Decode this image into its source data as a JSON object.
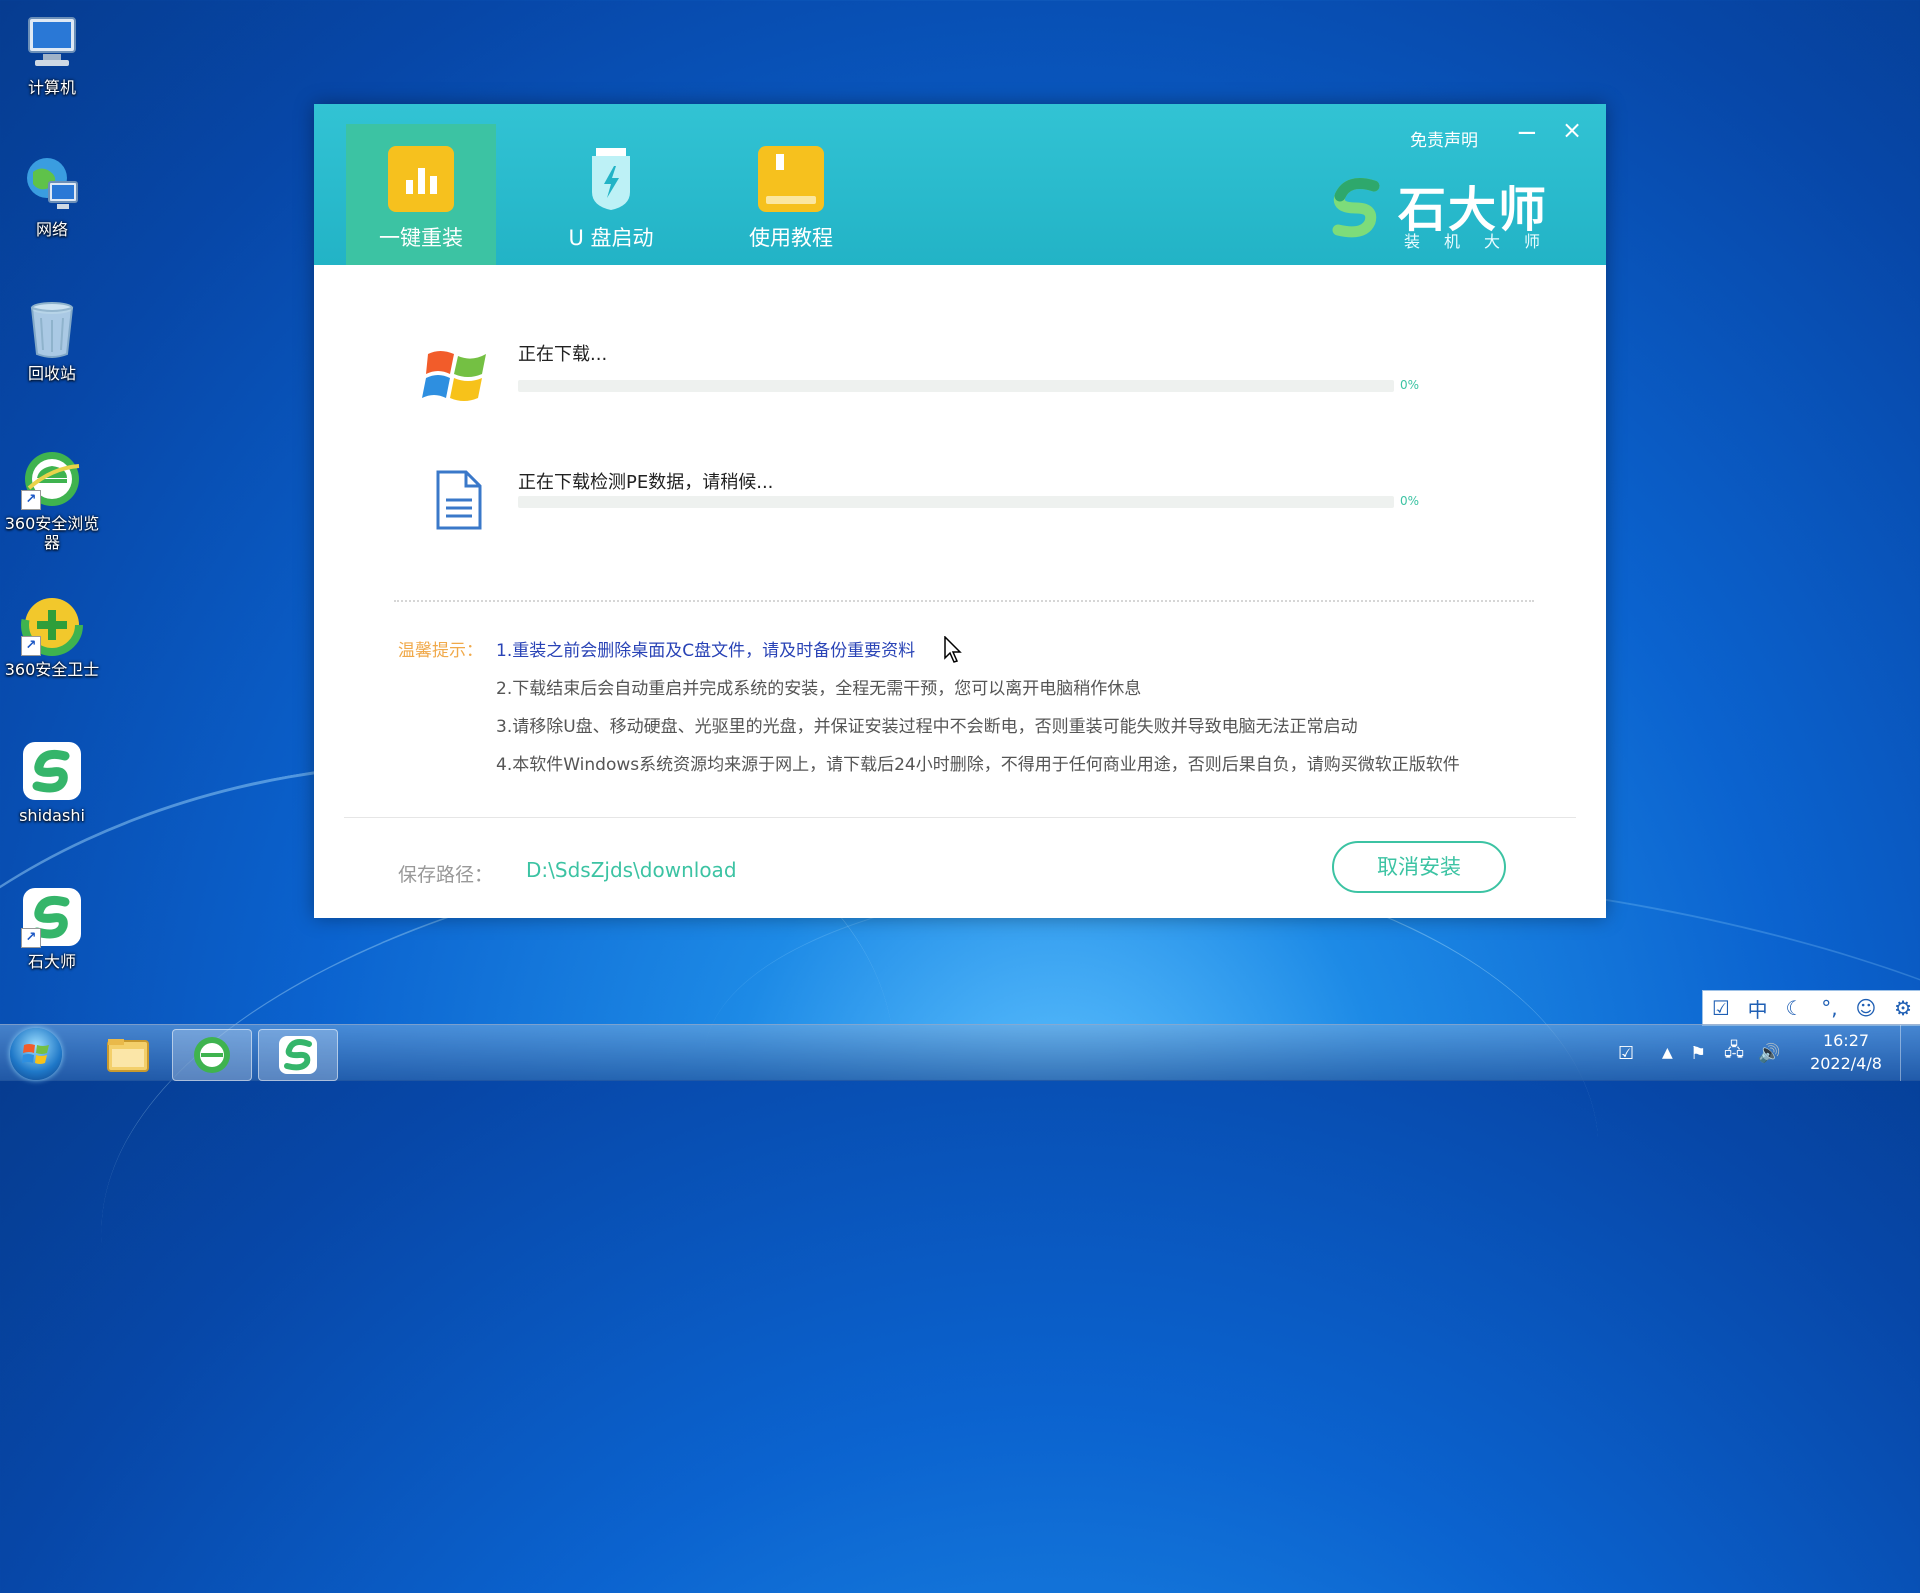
{
  "desktop": {
    "icons": [
      {
        "label": "计算机"
      },
      {
        "label": "网络"
      },
      {
        "label": "回收站"
      },
      {
        "label": "360安全浏览器"
      },
      {
        "label": "360安全卫士"
      },
      {
        "label": "shidashi"
      },
      {
        "label": "石大师"
      }
    ]
  },
  "window": {
    "tabs": [
      {
        "label": "一键重装",
        "icon": "bar-chart-icon",
        "active": true
      },
      {
        "label": "U 盘启动",
        "icon": "usb-drive-icon",
        "active": false
      },
      {
        "label": "使用教程",
        "icon": "book-icon",
        "active": false
      }
    ],
    "disclaimer": "免责声明",
    "minimize_label": "−",
    "close_label": "×",
    "logo": {
      "name": "石大师",
      "subtitle": "装机大师"
    },
    "downloads": [
      {
        "text": "正在下载...",
        "percent_text": "0%",
        "progress": 0
      },
      {
        "text": "正在下载检测PE数据，请稍候...",
        "percent_text": "0%",
        "progress": 0
      }
    ],
    "tips": {
      "label": "温馨提示：",
      "items": [
        "1.重装之前会删除桌面及C盘文件，请及时备份重要资料",
        "2.下载结束后会自动重启并完成系统的安装，全程无需干预，您可以离开电脑稍作休息",
        "3.请移除U盘、移动硬盘、光驱里的光盘，并保证安装过程中不会断电，否则重装可能失败并导致电脑无法正常启动",
        "4.本软件Windows系统资源均来源于网上，请下载后24小时删除，不得用于任何商业用途，否则后果自负，请购买微软正版软件"
      ]
    },
    "save_path": {
      "label": "保存路径：",
      "value": "D:\\SdsZjds\\download"
    },
    "cancel_label": "取消安装"
  },
  "ime": {
    "items": [
      "中"
    ]
  },
  "taskbar": {
    "clock_time": "16:27",
    "clock_date": "2022/4/8"
  },
  "colors": {
    "accent": "#3cc3a3",
    "header": "#28b8ca",
    "tip_highlight": "#2943b6",
    "tip_label": "#f0a94a"
  }
}
